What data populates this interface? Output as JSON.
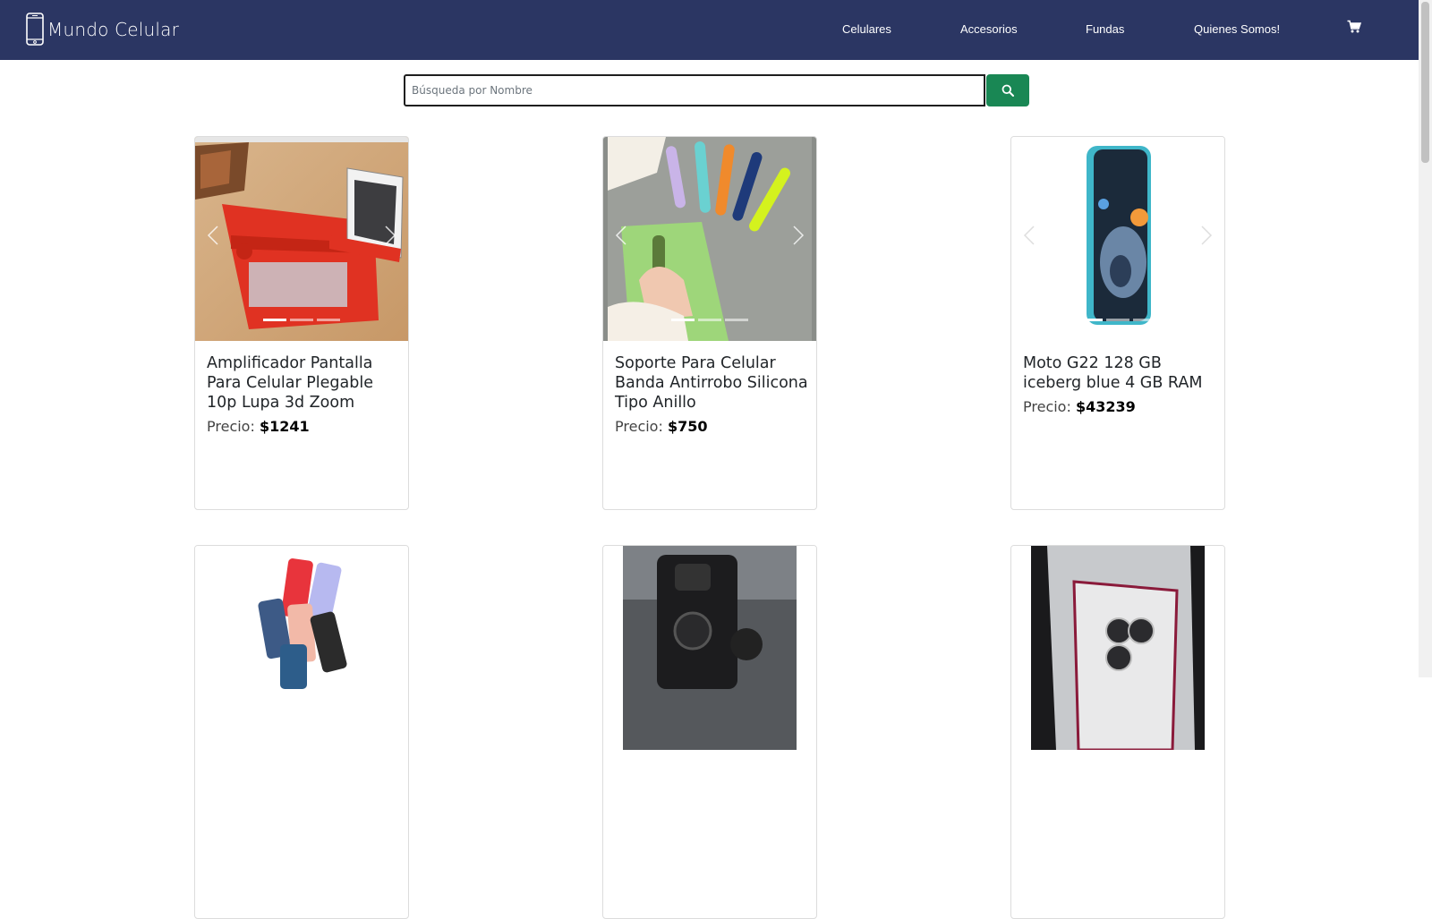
{
  "navbar": {
    "brand": "Mundo Celular",
    "links": [
      "Celulares",
      "Accesorios",
      "Fundas",
      "Quienes Somos!"
    ]
  },
  "search": {
    "placeholder": "Búsqueda por Nombre",
    "value": ""
  },
  "products": [
    {
      "name": "Amplificador Pantalla Para Celular Plegable 10p Lupa 3d Zoom",
      "price_label": "Precio:",
      "price": "$1241"
    },
    {
      "name": "Soporte Para Celular Banda Antirrobo Silicona Tipo Anillo",
      "price_label": "Precio:",
      "price": "$750"
    },
    {
      "name": "Moto G22 128 GB iceberg blue 4 GB RAM",
      "price_label": "Precio:",
      "price": "$43239"
    }
  ],
  "colors": {
    "navbar": "#2b3663",
    "search_button": "#198754"
  },
  "icons": {
    "brand": "phone-icon",
    "cart": "cart-icon",
    "search": "search-icon"
  }
}
